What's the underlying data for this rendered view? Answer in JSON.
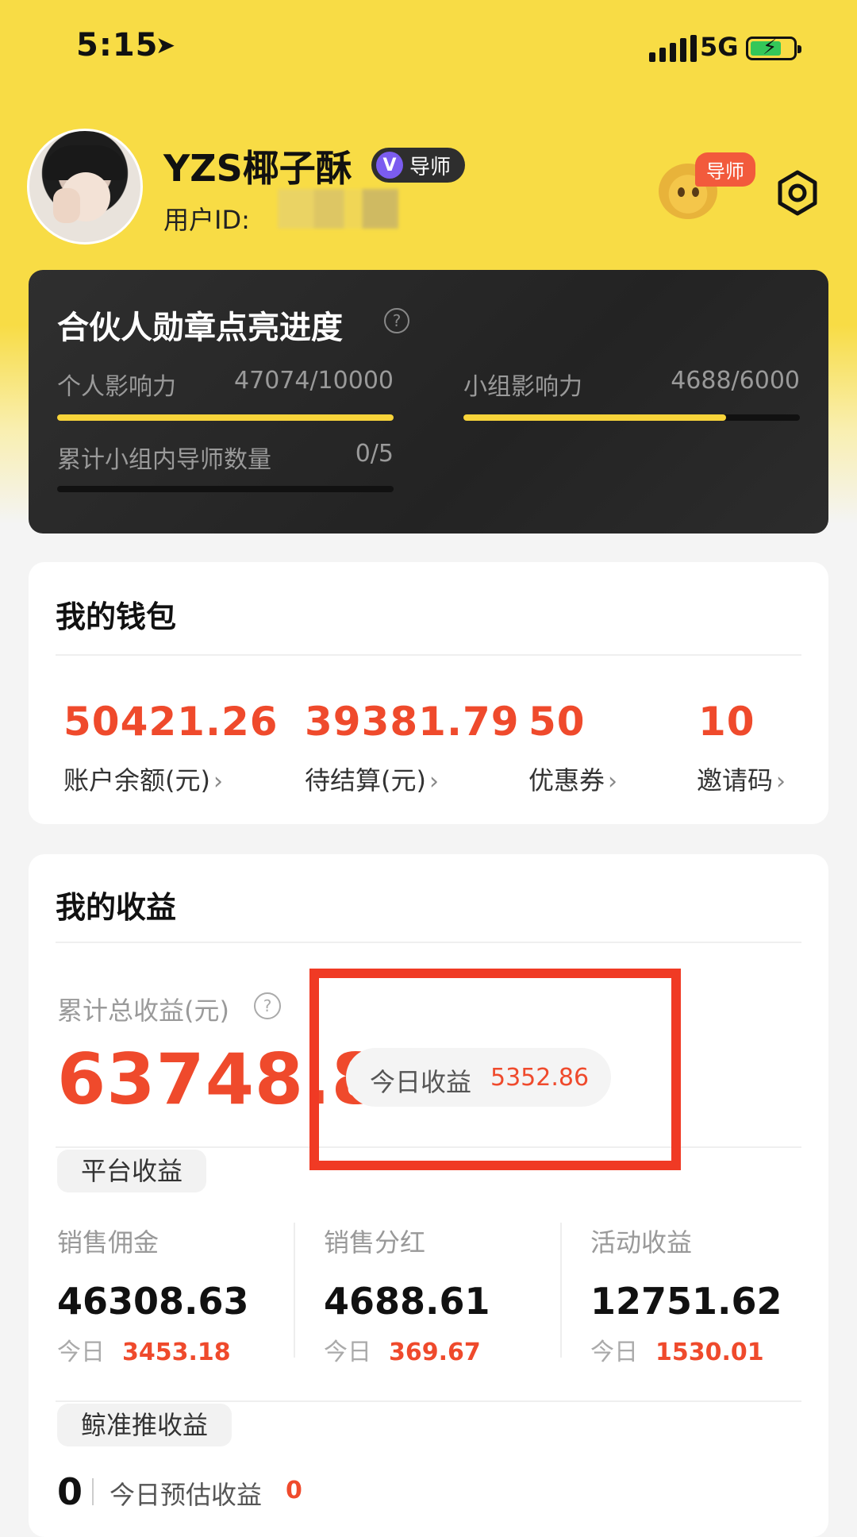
{
  "status_bar": {
    "time": "5:15",
    "network": "5G"
  },
  "profile": {
    "username": "YZS椰子酥",
    "badge_v": "V",
    "badge_label": "导师",
    "user_id_label": "用户ID:",
    "mentor_tag": "导师"
  },
  "partner": {
    "title": "合伙人勋章点亮进度",
    "help": "?",
    "personal_label": "个人影响力",
    "personal_value": "47074/10000",
    "personal_progress": 1.0,
    "group_label": "小组影响力",
    "group_value": "4688/6000",
    "group_progress": 0.781,
    "mentor_count_label": "累计小组内导师数量",
    "mentor_count_value": "0/5",
    "mentor_count_progress": 0
  },
  "wallet": {
    "title": "我的钱包",
    "items": [
      {
        "value": "50421.26",
        "label": "账户余额(元)"
      },
      {
        "value": "39381.79",
        "label": "待结算(元)"
      },
      {
        "value": "50",
        "label": "优惠券"
      },
      {
        "value": "10",
        "label": "邀请码"
      }
    ]
  },
  "income": {
    "title": "我的收益",
    "total_label": "累计总收益(元)",
    "help": "?",
    "total_value": "63748.86",
    "today_label": "今日收益",
    "today_value": "5352.86",
    "platform_tag": "平台收益",
    "today_word": "今日",
    "columns": [
      {
        "title": "销售佣金",
        "value": "46308.63",
        "today": "3453.18"
      },
      {
        "title": "销售分红",
        "value": "4688.61",
        "today": "369.67"
      },
      {
        "title": "活动收益",
        "value": "12751.62",
        "today": "1530.01"
      }
    ],
    "jingzhuntui_tag": "鲸准推收益",
    "jzt_value": "0",
    "jzt_today_label": "今日预估收益",
    "jzt_today_value": "0"
  },
  "colors": {
    "brand_yellow": "#f8dc45",
    "accent_red": "#ef4a2c",
    "highlight_box": "#f03a24"
  }
}
